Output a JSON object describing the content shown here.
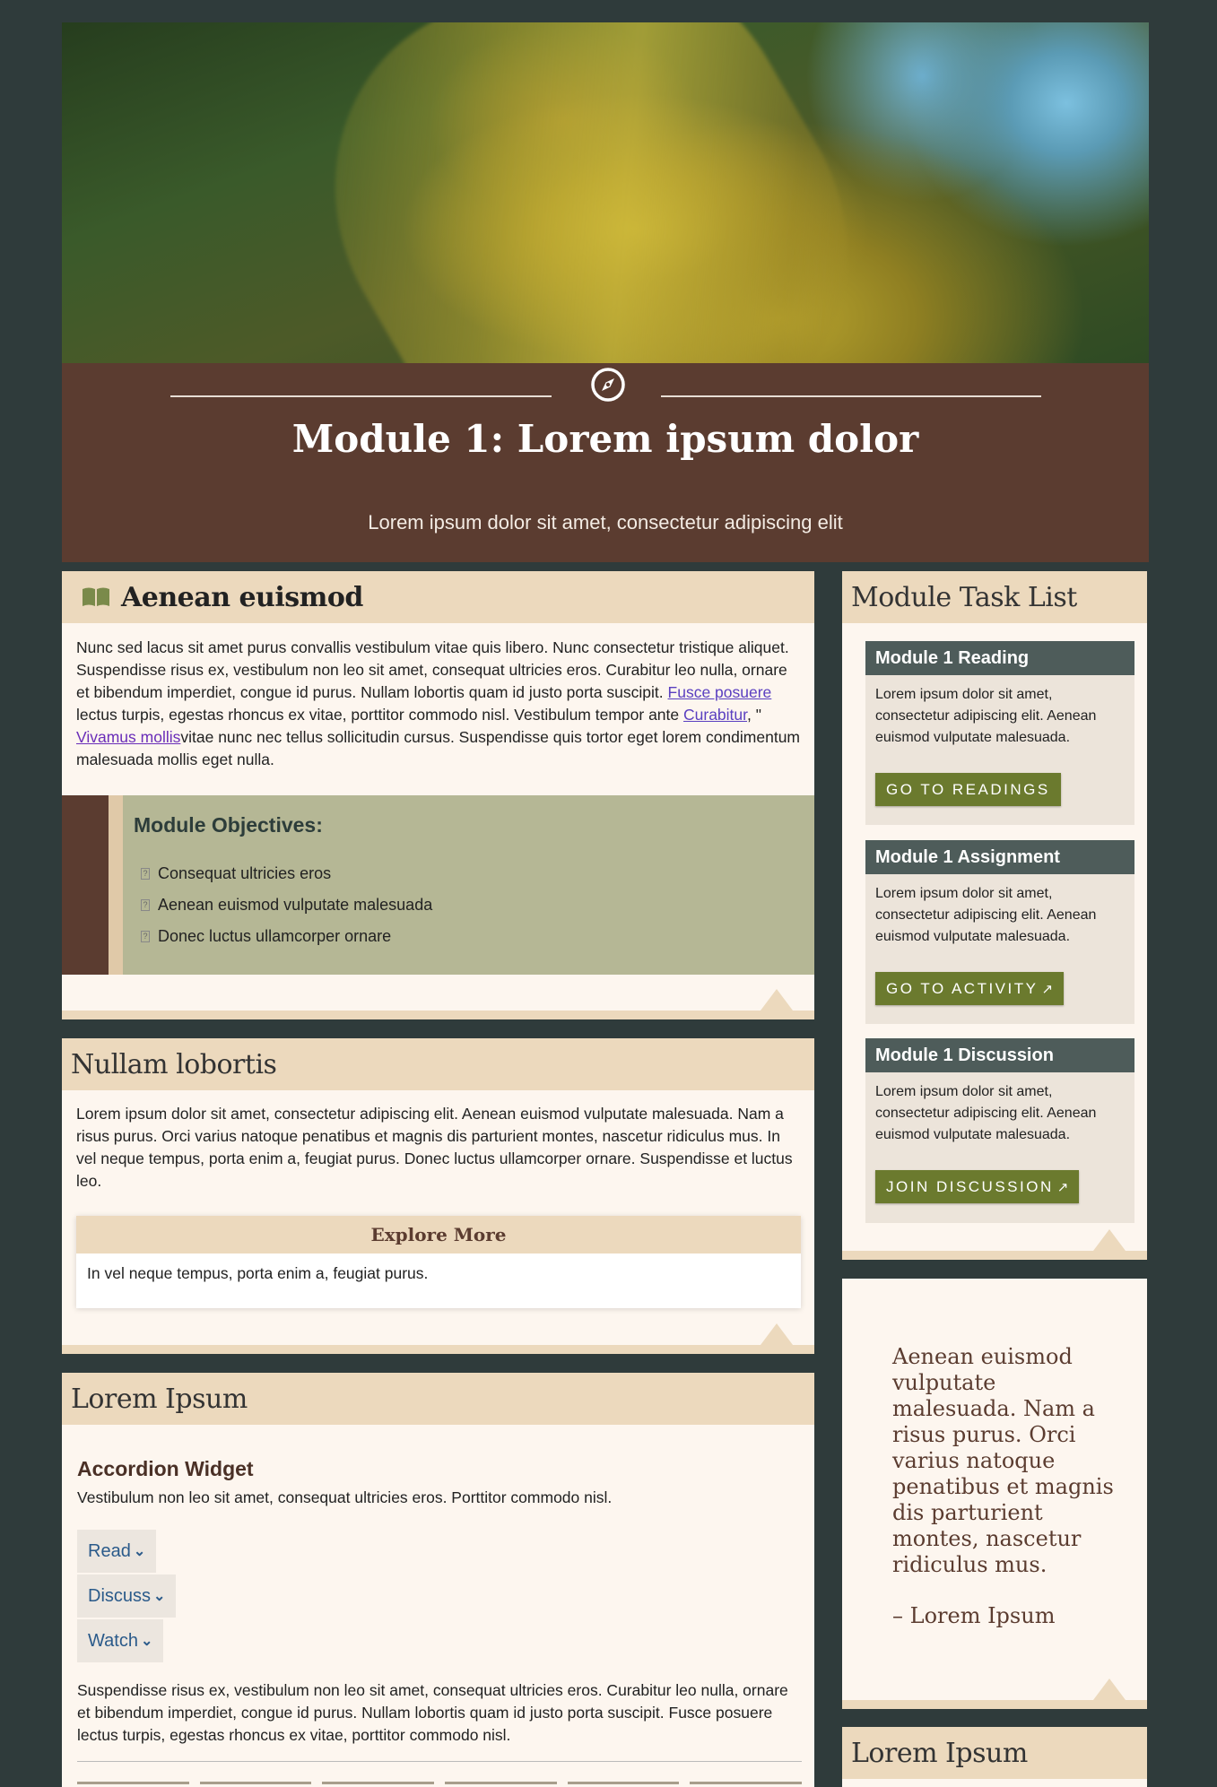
{
  "banner": {
    "title": "Module 1: Lorem ipsum dolor",
    "subtitle": "Lorem ipsum dolor sit amet, consectetur adipiscing elit"
  },
  "card1": {
    "title": "Aenean euismod",
    "intro_a": "Nunc sed lacus sit amet purus convallis vestibulum vitae quis libero. Nunc consectetur tristique aliquet. Suspendisse risus ex, vestibulum non leo sit amet, consequat ultricies eros. Curabitur leo nulla, ornare et bibendum imperdiet, congue id purus. Nullam lobortis quam id justo porta suscipit. ",
    "link1": "Fusce posuere",
    "intro_b": " lectus turpis, egestas rhoncus ex vitae, porttitor commodo nisl. Vestibulum tempor ante ",
    "link2": "Curabitur",
    "intro_c": ", \" ",
    "link3": "Vivamus mollis",
    "intro_d": "vitae nunc nec tellus sollicitudin cursus. Suspendisse quis tortor eget lorem condimentum malesuada mollis eget nulla.",
    "objectives_title": "Module Objectives:",
    "objectives": [
      "Consequat ultricies eros",
      "Aenean euismod vulputate malesuada",
      "Donec luctus ullamcorper ornare"
    ]
  },
  "card2": {
    "title": "Nullam lobortis",
    "text": "Lorem ipsum dolor sit amet, consectetur adipiscing elit. Aenean euismod vulputate malesuada. Nam a risus purus. Orci varius natoque penatibus et magnis dis parturient montes, nascetur ridiculus mus. In vel neque tempus, porta enim a, feugiat purus. Donec luctus ullamcorper ornare. Suspendisse et luctus leo.",
    "explore_title": "Explore More",
    "explore_text": "In vel neque tempus, porta enim a, feugiat purus."
  },
  "card3": {
    "title": "Lorem Ipsum",
    "accordion_title": "Accordion Widget",
    "accordion_desc": "Vestibulum non leo sit amet, consequat ultricies eros. Porttitor commodo nisl.",
    "buttons": [
      "Read",
      "Discuss",
      "Watch"
    ],
    "para": "Suspendisse risus ex, vestibulum non leo sit amet, consequat ultricies eros. Curabitur leo nulla, ornare et bibendum imperdiet, congue id purus. Nullam lobortis quam id justo porta suscipit. Fusce posuere lectus turpis, egestas rhoncus ex vitae, porttitor commodo nisl."
  },
  "tasklist": {
    "title": "Module Task List",
    "tasks": [
      {
        "title": "Module 1 Reading",
        "text": "Lorem ipsum dolor sit amet, consectetur adipiscing elit. Aenean euismod vulputate malesuada.",
        "button": "GO TO READINGS"
      },
      {
        "title": "Module 1 Assignment",
        "text": "Lorem ipsum dolor sit amet, consectetur adipiscing elit. Aenean euismod vulputate malesuada.",
        "button": "GO TO ACTIVITY"
      },
      {
        "title": "Module 1 Discussion",
        "text": "Lorem ipsum dolor sit amet, consectetur adipiscing elit. Aenean euismod vulputate malesuada.",
        "button": "JOIN DISCUSSION"
      }
    ]
  },
  "quote": {
    "text": "Aenean euismod vulputate malesuada. Nam a risus purus. Orci varius natoque penatibus et magnis dis parturient montes, nascetur ridiculus mus.",
    "author": "– Lorem Ipsum"
  },
  "card_bottom_right": {
    "title": "Lorem Ipsum"
  },
  "colors": {
    "page_bg": "#2f3b3b",
    "banner_brown": "#5b3c30",
    "header_tan": "#ecd9bd",
    "olive_button": "#6b7a2e",
    "task_header": "#4e5c5a",
    "objectives_bg": "#b5b795"
  },
  "icons": {
    "banner": "compass-icon",
    "card1": "book-icon",
    "external": "external-link-icon",
    "chevron": "chevron-down-icon"
  }
}
